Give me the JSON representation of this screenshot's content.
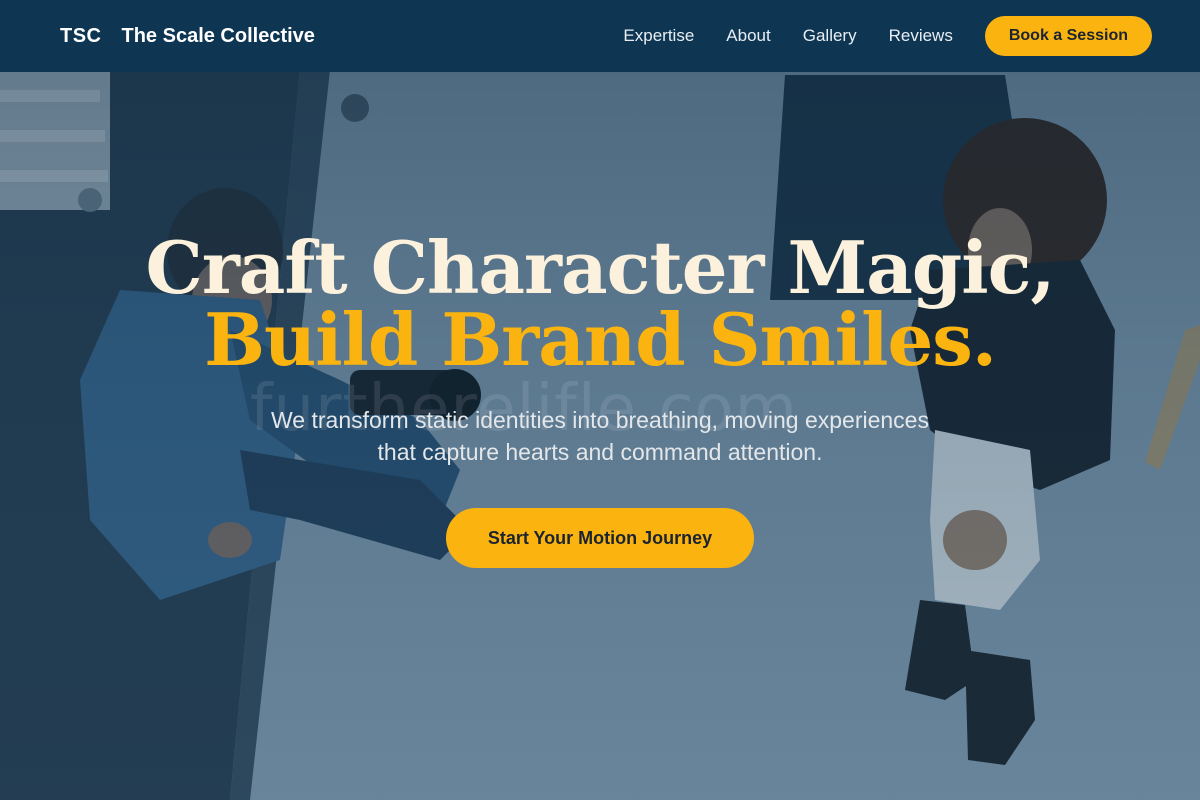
{
  "nav": {
    "logo_mark": "TSC",
    "brand_name": "The Scale Collective",
    "links": [
      "Expertise",
      "About",
      "Gallery",
      "Reviews"
    ],
    "cta_label": "Book a Session"
  },
  "hero": {
    "headline_line1": "Craft Character Magic,",
    "headline_line2": "Build Brand Smiles.",
    "subtitle": "We transform static identities into breathing, moving experiences that capture hearts and command attention.",
    "cta_label": "Start Your Motion Journey",
    "watermark": "furtherelifle.com"
  },
  "colors": {
    "navbar": "#0e3552",
    "accent": "#fbb40f",
    "headline_light": "#fbf1dc"
  }
}
